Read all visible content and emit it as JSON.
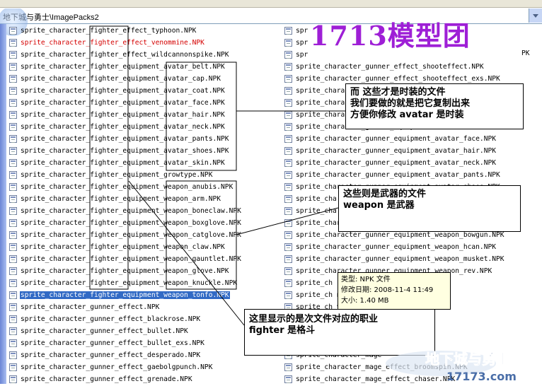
{
  "address": {
    "path": "地下城与勇士\\ImagePacks2"
  },
  "watermark_text": "1713模型团",
  "left_column": [
    {
      "name": "sprite_character_fighter_effect_typhoon.NPK",
      "state": "normal"
    },
    {
      "name": "sprite_character_fighter_effect_venommine.NPK",
      "state": "red"
    },
    {
      "name": "sprite_character_fighter_effect_wildcannonspike.NPK",
      "state": "normal"
    },
    {
      "name": "sprite_character_fighter_equipment_avatar_belt.NPK",
      "state": "normal"
    },
    {
      "name": "sprite_character_fighter_equipment_avatar_cap.NPK",
      "state": "normal"
    },
    {
      "name": "sprite_character_fighter_equipment_avatar_coat.NPK",
      "state": "normal"
    },
    {
      "name": "sprite_character_fighter_equipment_avatar_face.NPK",
      "state": "normal"
    },
    {
      "name": "sprite_character_fighter_equipment_avatar_hair.NPK",
      "state": "normal"
    },
    {
      "name": "sprite_character_fighter_equipment_avatar_neck.NPK",
      "state": "normal"
    },
    {
      "name": "sprite_character_fighter_equipment_avatar_pants.NPK",
      "state": "normal"
    },
    {
      "name": "sprite_character_fighter_equipment_avatar_shoes.NPK",
      "state": "normal"
    },
    {
      "name": "sprite_character_fighter_equipment_avatar_skin.NPK",
      "state": "normal"
    },
    {
      "name": "sprite_character_fighter_equipment_growtype.NPK",
      "state": "normal"
    },
    {
      "name": "sprite_character_fighter_equipment_weapon_anubis.NPK",
      "state": "normal"
    },
    {
      "name": "sprite_character_fighter_equipment_weapon_arm.NPK",
      "state": "normal"
    },
    {
      "name": "sprite_character_fighter_equipment_weapon_boneclaw.NPK",
      "state": "normal"
    },
    {
      "name": "sprite_character_fighter_equipment_weapon_boxglove.NPK",
      "state": "normal"
    },
    {
      "name": "sprite_character_fighter_equipment_weapon_catglove.NPK",
      "state": "normal"
    },
    {
      "name": "sprite_character_fighter_equipment_weapon_claw.NPK",
      "state": "normal"
    },
    {
      "name": "sprite_character_fighter_equipment_weapon_gauntlet.NPK",
      "state": "normal"
    },
    {
      "name": "sprite_character_fighter_equipment_weapon_glove.NPK",
      "state": "normal"
    },
    {
      "name": "sprite_character_fighter_equipment_weapon_knuckle.NPK",
      "state": "normal"
    },
    {
      "name": "sprite_character_fighter_equipment_weapon_tonfo.NPK",
      "state": "selected"
    },
    {
      "name": "sprite_character_gunner_effect.NPK",
      "state": "normal"
    },
    {
      "name": "sprite_character_gunner_effect_blackrose.NPK",
      "state": "normal"
    },
    {
      "name": "sprite_character_gunner_effect_bullet.NPK",
      "state": "normal"
    },
    {
      "name": "sprite_character_gunner_effect_bullet_exs.NPK",
      "state": "normal"
    },
    {
      "name": "sprite_character_gunner_effect_desperado.NPK",
      "state": "normal"
    },
    {
      "name": "sprite_character_gunner_effect_gaebolgpunch.NPK",
      "state": "normal"
    },
    {
      "name": "sprite_character_gunner_effect_grenade.NPK",
      "state": "normal"
    }
  ],
  "right_column": [
    {
      "name": "spr",
      "state": "normal"
    },
    {
      "name": "spr",
      "state": "normal"
    },
    {
      "name": "spr",
      "state": "normal"
    },
    {
      "name": "sprite_character_gunner_effect_shooteffect.NPK",
      "state": "normal"
    },
    {
      "name": "sprite_character_gunner_effect_shooteffect_exs.NPK",
      "state": "normal"
    },
    {
      "name": "sprite_chara",
      "state": "normal"
    },
    {
      "name": "sprite_chara",
      "state": "normal"
    },
    {
      "name": "sprite_chara",
      "state": "normal"
    },
    {
      "name": "sprite_character_gunner_equip",
      "state": "normal"
    },
    {
      "name": "sprite_character_gunner_equipment_avatar_face.NPK",
      "state": "normal"
    },
    {
      "name": "sprite_character_gunner_equipment_avatar_hair.NPK",
      "state": "normal"
    },
    {
      "name": "sprite_character_gunner_equipment_avatar_neck.NPK",
      "state": "normal"
    },
    {
      "name": "sprite_character_gunner_equipment_avatar_pants.NPK",
      "state": "normal"
    },
    {
      "name": "sprite_character_gunner_equipment_avatar_shoes.NPK",
      "state": "normal"
    },
    {
      "name": "sprite_cha",
      "state": "normal"
    },
    {
      "name": "sprite_cha",
      "state": "normal"
    },
    {
      "name": "sprite_character_gunner_equipment_weapon_auto.NPK",
      "state": "normal"
    },
    {
      "name": "sprite_character_gunner_equipment_weapon_bowgun.NPK",
      "state": "normal"
    },
    {
      "name": "sprite_character_gunner_equipment_weapon_hcan.NPK",
      "state": "normal"
    },
    {
      "name": "sprite_character_gunner_equipment_weapon_musket.NPK",
      "state": "normal"
    },
    {
      "name": "sprite_character_gunner_equipment_weapon_rev.NPK",
      "state": "normal"
    },
    {
      "name": "sprite_ch",
      "state": "normal"
    },
    {
      "name": "sprite_ch                          nd.NPK",
      "state": "normal"
    },
    {
      "name": "sprite_ch                         vity.NPK",
      "state": "normal"
    },
    {
      "name": "sprite_ch                          ld.NPK",
      "state": "normal"
    },
    {
      "name": "sprite_ch                           x NPK",
      "state": "normal"
    },
    {
      "name": "sprite_ch                           e.NPK",
      "state": "normal"
    },
    {
      "name": "sprite_character_mage",
      "state": "normal"
    },
    {
      "name": "sprite_character_mage_effect_broomspin.NPK",
      "state": "normal"
    },
    {
      "name": "sprite_character_mage_effect_chaser.NPK",
      "state": "normal"
    }
  ],
  "overflow_fragment": "PK",
  "callouts": {
    "avatar": {
      "lines": [
        "而 这些才是时装的文件",
        "我们要做的就是把它复制出来",
        "方便你修改 avatar  是时装"
      ]
    },
    "weapon": {
      "lines": [
        "这些则是武器的文件",
        "weapon  是武器"
      ]
    },
    "fighter": {
      "lines": [
        "这里显示的是次文件对应的职业",
        "fighter  是格斗"
      ]
    }
  },
  "tooltip": {
    "type_line": "类型: NPK 文件",
    "date_line": "修改日期: 2008-11-4 11:49",
    "size_line": "大小: 1.40 MB"
  },
  "logo_text": "地下城与勇士",
  "logo_url": "17173.com"
}
